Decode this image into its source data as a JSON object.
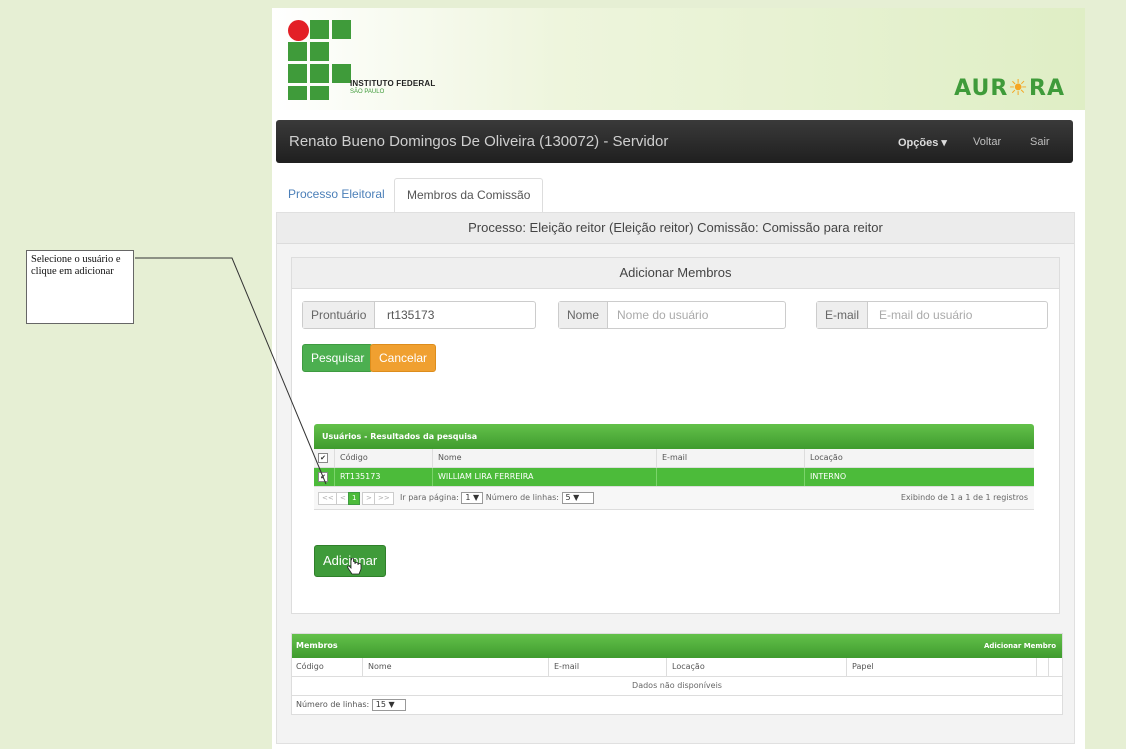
{
  "header": {
    "institute_line1": "INSTITUTO FEDERAL",
    "institute_line2": "SÃO PAULO",
    "aurora_left": "AUR",
    "aurora_right": "RA",
    "aurora_sun_icon": "sun-icon"
  },
  "navbar": {
    "user": "Renato Bueno Domingos De Oliveira (130072) - Servidor",
    "options": "Opções ▾",
    "back": "Voltar",
    "exit": "Sair"
  },
  "tabs": [
    {
      "label": "Processo Eleitoral"
    },
    {
      "label": "Membros da Comissão"
    }
  ],
  "process_title": "Processo: Eleição reitor (Eleição reitor) Comissão: Comissão para reitor",
  "add_panel": {
    "title": "Adicionar Membros",
    "prontuario_label": "Prontuário",
    "prontuario_value": "rt135173",
    "nome_label": "Nome",
    "nome_placeholder": "Nome do usuário",
    "email_label": "E-mail",
    "email_placeholder": "E-mail do usuário",
    "search_button": "Pesquisar",
    "cancel_button": "Cancelar",
    "add_button": "Adicionar"
  },
  "results": {
    "title": "Usuários - Resultados da pesquisa",
    "columns": [
      "Código",
      "Nome",
      "E-mail",
      "Locação"
    ],
    "rows": [
      {
        "codigo": "RT135173",
        "nome": "WILLIAM LIRA FERREIRA",
        "email": "",
        "locacao": "INTERNO"
      }
    ],
    "pager": {
      "first": "<<",
      "prev": "<",
      "page": "1",
      "next": ">",
      "last": ">>",
      "goto_label": "Ir para página:",
      "goto_value": "1",
      "rows_label": "Número de linhas:",
      "rows_value": "5",
      "summary": "Exibindo de 1 a 1 de 1 registros"
    }
  },
  "members": {
    "title": "Membros",
    "add_link": "Adicionar Membro",
    "columns": [
      "Código",
      "Nome",
      "E-mail",
      "Locação",
      "Papel"
    ],
    "empty": "Dados não disponíveis",
    "rows_label": "Número de linhas:",
    "rows_value": "15"
  },
  "callout": {
    "text": "Selecione o usuário e clique em adicionar"
  }
}
